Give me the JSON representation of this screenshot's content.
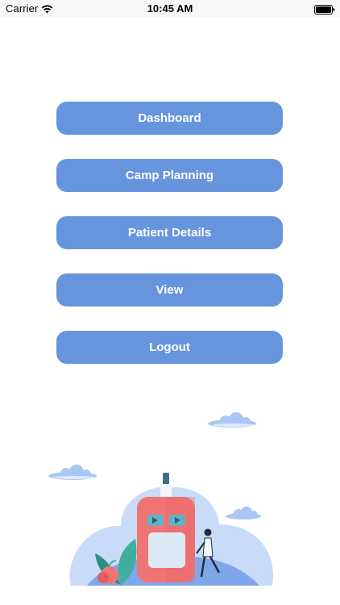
{
  "status_bar": {
    "carrier": "Carrier",
    "time": "10:45 AM"
  },
  "menu": {
    "items": [
      {
        "label": "Dashboard"
      },
      {
        "label": "Camp Planning"
      },
      {
        "label": "Patient Details"
      },
      {
        "label": "View"
      },
      {
        "label": "Logout"
      }
    ]
  },
  "colors": {
    "button": "#6795dd",
    "button_text": "#ffffff",
    "illustration_blob": "#c8dcf8",
    "device_body": "#f07473"
  },
  "icons": [
    "wifi-icon",
    "battery-icon"
  ]
}
